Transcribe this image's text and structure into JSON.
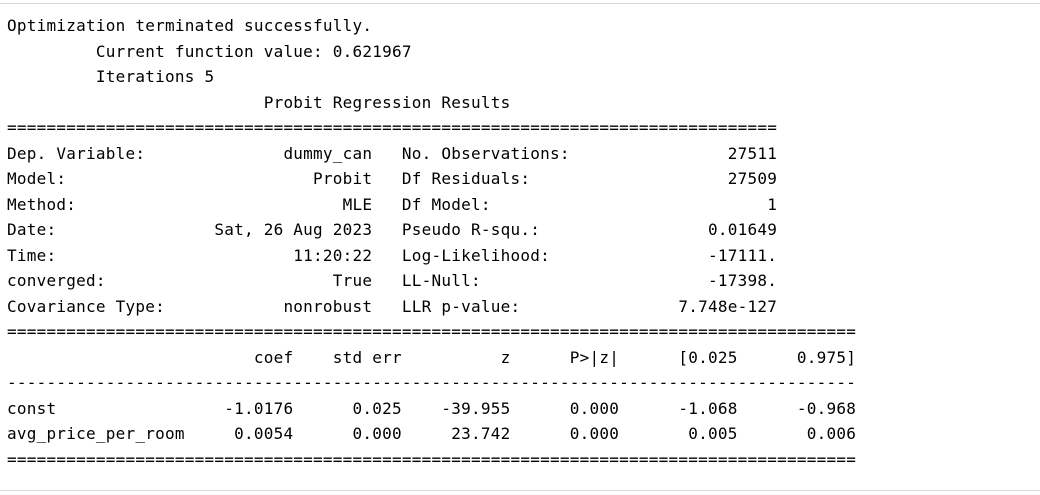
{
  "output": {
    "header": [
      "Optimization terminated successfully.",
      "         Current function value: 0.621967",
      "         Iterations 5"
    ],
    "title_line": "                          Probit Regression Results",
    "rule_short": "==============================================================================",
    "summary_rows": [
      "Dep. Variable:              dummy_can   No. Observations:                27511",
      "Model:                         Probit   Df Residuals:                    27509",
      "Method:                           MLE   Df Model:                            1",
      "Date:                Sat, 26 Aug 2023   Pseudo R-squ.:                 0.01649",
      "Time:                        11:20:22   Log-Likelihood:                -17111.",
      "converged:                       True   LL-Null:                       -17398.",
      "Covariance Type:            nonrobust   LLR p-value:                7.748e-127"
    ],
    "rule_long": "======================================================================================",
    "coef_header": "                         coef    std err          z      P>|z|      [0.025      0.975]",
    "rule_dash": "--------------------------------------------------------------------------------------",
    "coef_rows": [
      "const                 -1.0176      0.025    -39.955      0.000      -1.068      -0.968",
      "avg_price_per_room     0.0054      0.000     23.742      0.000       0.005       0.006"
    ],
    "rule_long_end": "======================================================================================"
  }
}
